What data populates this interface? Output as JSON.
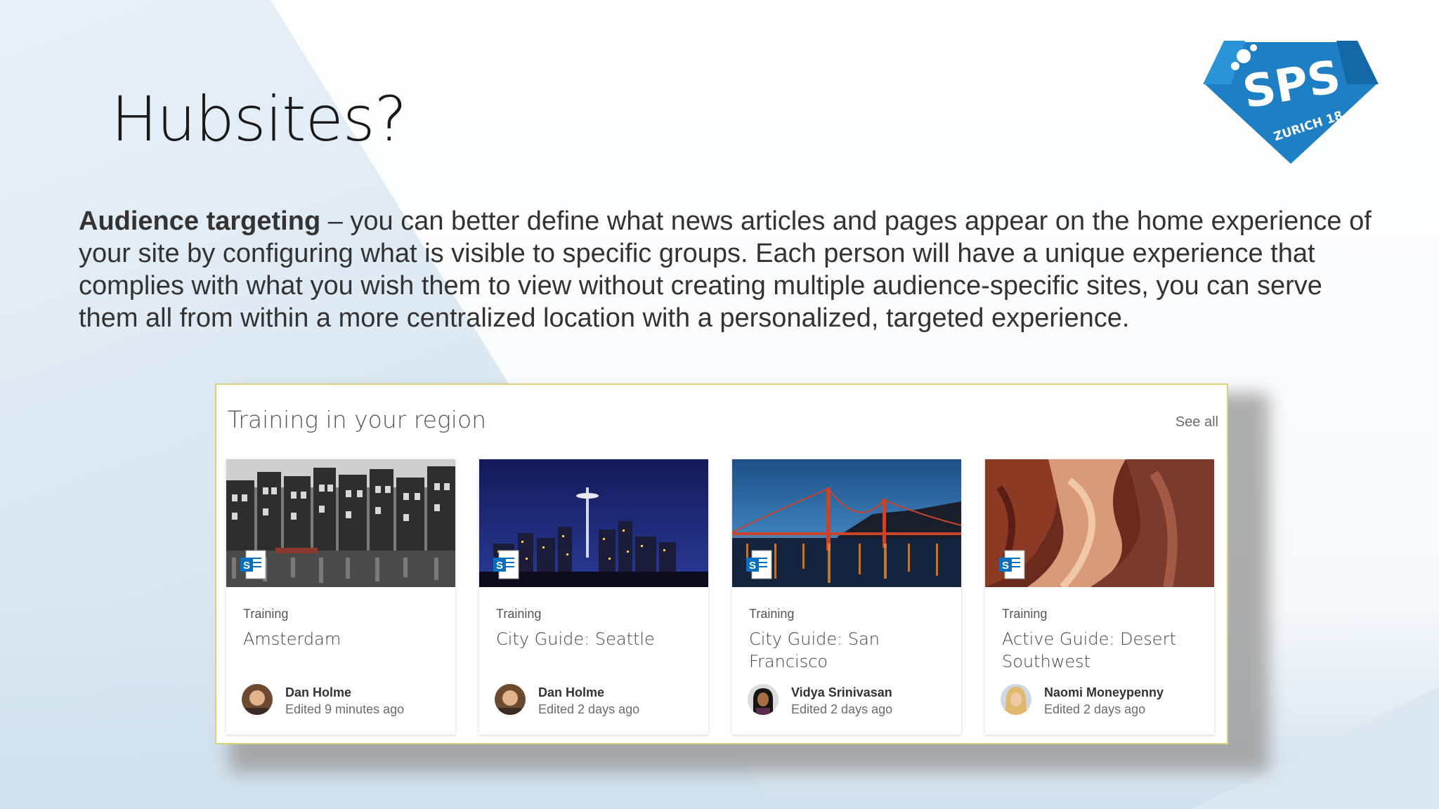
{
  "slide": {
    "title": "Hubsites?",
    "body_bold": "Audience targeting",
    "body_rest": " – you can better define what news articles and pages appear on the home experience of your site by configuring what is visible to specific groups. Each person will have a unique experience that complies with what you wish them to view without creating multiple audience-specific sites, you can serve them all from within a more centralized location with a personalized, targeted experience."
  },
  "logo": {
    "text": "SPS",
    "subtext": "ZURICH 18",
    "color": "#1e7fc4"
  },
  "webpart": {
    "title": "Training in your region",
    "see_all": "See all",
    "cards": [
      {
        "category": "Training",
        "name": "Amsterdam",
        "author": "Dan Holme",
        "edited": "Edited 9 minutes ago",
        "image": "amsterdam-canal-houses",
        "avatar": "male-avatar"
      },
      {
        "category": "Training",
        "name": "City Guide: Seattle",
        "author": "Dan Holme",
        "edited": "Edited 2 days ago",
        "image": "seattle-night-skyline",
        "avatar": "male-avatar"
      },
      {
        "category": "Training",
        "name": "City Guide: San Francisco",
        "author": "Vidya Srinivasan",
        "edited": "Edited 2 days ago",
        "image": "golden-gate-bridge-sunset",
        "avatar": "female-avatar-dark-hair"
      },
      {
        "category": "Training",
        "name": "Active Guide: Desert Southwest",
        "author": "Naomi Moneypenny",
        "edited": "Edited 2 days ago",
        "image": "antelope-canyon",
        "avatar": "female-avatar-blonde"
      }
    ]
  }
}
